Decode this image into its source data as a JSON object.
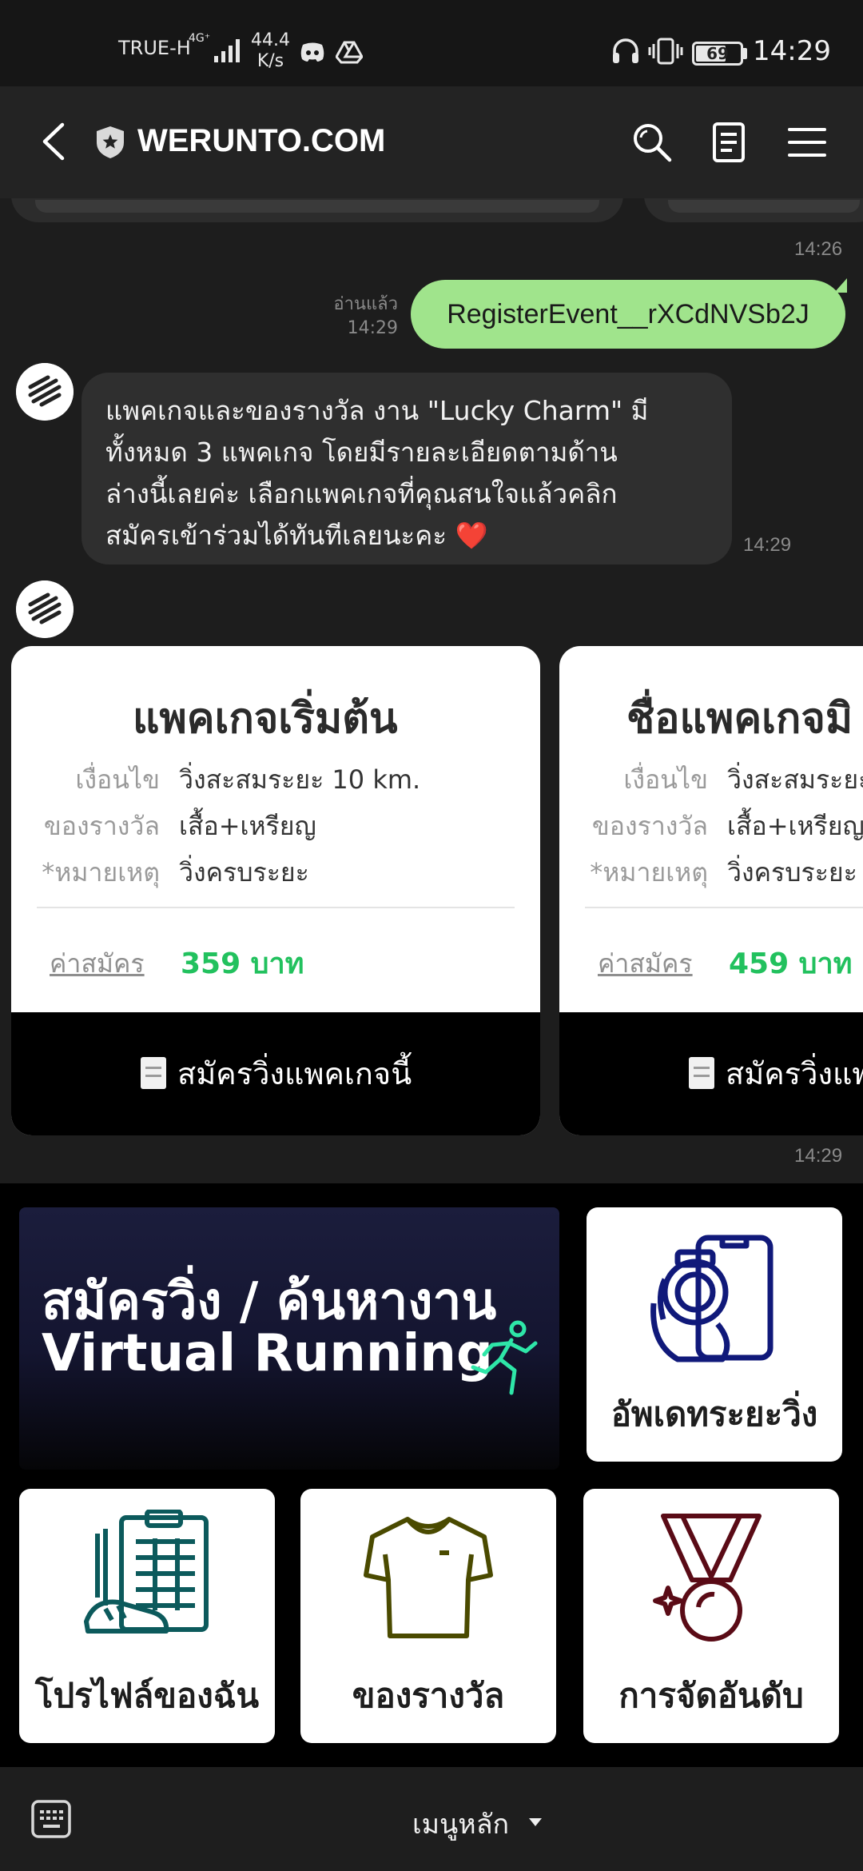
{
  "status_bar": {
    "carrier": "TRUE-H",
    "network": "4G⁺",
    "speed_value": "44.4",
    "speed_unit": "K/s",
    "battery": "69",
    "battery_level": 0.69,
    "time": "14:29"
  },
  "header": {
    "title": "WERUNTO.COM"
  },
  "chat": {
    "prev_timestamp": "14:26",
    "outgoing": {
      "read_label": "อ่านแล้ว",
      "time": "14:29",
      "text": "RegisterEvent__rXCdNVSb2J"
    },
    "incoming": {
      "text": "แพคเกจและของรางวัล งาน \"Lucky Charm\" มี\nทั้งหมด 3 แพคเกจ โดยมีรายละเอียดตามด้าน\nล่างนี้เลยค่ะ เลือกแพคเกจที่คุณสนใจแล้วคลิก\nสมัครเข้าร่วมได้ทันทีเลยนะคะ ❤️",
      "time": "14:29"
    },
    "cards_timestamp": "14:29"
  },
  "packages": [
    {
      "title": "แพคเกจเริ่มต้น",
      "condition_label": "เงื่อนไข",
      "condition": "วิ่งสะสมระยะ 10 km.",
      "reward_label": "ของรางวัล",
      "reward": "เสื้อ+เหรียญ",
      "note_label": "*หมายเหตุ",
      "note": "วิ่งครบระยะ",
      "fee_label": "ค่าสมัคร",
      "fee": "359 บาท",
      "button": "สมัครวิ่งแพคเกจนี้"
    },
    {
      "title": "ชื่อแพคเกจมิ",
      "condition_label": "เงื่อนไข",
      "condition": "วิ่งสะสมระยะ",
      "reward_label": "ของรางวัล",
      "reward": "เสื้อ+เหรียญ",
      "note_label": "*หมายเหตุ",
      "note": "วิ่งครบระยะ",
      "fee_label": "ค่าสมัคร",
      "fee": "459 บาท",
      "button": "สมัครวิ่งแพ"
    }
  ],
  "rich_menu": {
    "banner_line1": "สมัครวิ่ง / ค้นหางาน",
    "banner_line2": "Virtual Running",
    "tiles": [
      {
        "label": "อัพเดทระยะวิ่ง",
        "icon": "update-distance-icon"
      },
      {
        "label": "โปรไฟล์ของฉัน",
        "icon": "profile-clipboard-icon"
      },
      {
        "label": "ของรางวัล",
        "icon": "shirt-icon"
      },
      {
        "label": "การจัดอันดับ",
        "icon": "medal-icon"
      }
    ]
  },
  "bottom_bar": {
    "menu_label": "เมนูหลัก"
  },
  "colors": {
    "outgoing_bubble": "#a0e48c",
    "fee_green": "#22c15e",
    "background": "#1d1d1d",
    "incoming_bubble": "#2f2f2f"
  }
}
